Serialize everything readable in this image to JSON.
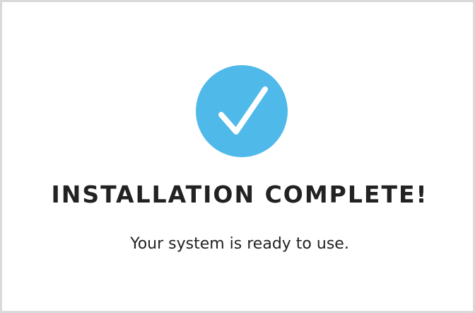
{
  "dialog": {
    "title": "INSTALLATION COMPLETE!",
    "message": "Your system is ready to use.",
    "icon": "checkmark-circle-icon"
  },
  "colors": {
    "accent": "#4fb9ea",
    "text": "#222222",
    "border": "#d9d9d9",
    "background": "#ffffff"
  }
}
